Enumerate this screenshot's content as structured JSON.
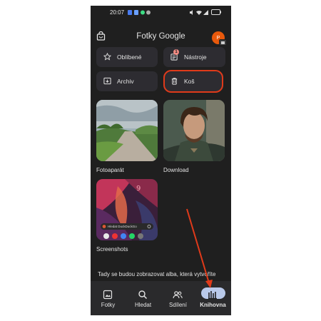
{
  "status_bar": {
    "time": "20:07",
    "battery": "87"
  },
  "app": {
    "title": "Fotky Google",
    "avatar_letter": "P"
  },
  "tiles": [
    {
      "label": "Oblíbené",
      "icon": "star-icon"
    },
    {
      "label": "Nástroje",
      "icon": "tools-icon",
      "badge": "1"
    },
    {
      "label": "Archiv",
      "icon": "archive-icon"
    },
    {
      "label": "Koš",
      "icon": "trash-icon"
    }
  ],
  "albums": [
    {
      "label": "Fotoaparát"
    },
    {
      "label": "Download"
    },
    {
      "label": "Screenshots",
      "search_hint": "Hledat DuckDuckGo"
    }
  ],
  "info_text": "Tady se budou zobrazovat alba, která vytvoříte",
  "nav": [
    {
      "label": "Fotky",
      "icon": "photo-icon"
    },
    {
      "label": "Hledat",
      "icon": "search-icon"
    },
    {
      "label": "Sdílení",
      "icon": "people-icon"
    },
    {
      "label": "Knihovna",
      "icon": "library-icon",
      "active": true
    }
  ],
  "colors": {
    "background": "#1f1f1f",
    "tile": "#2d2c31",
    "highlight": "#e03a1a",
    "active_pill": "#b9c9ea"
  }
}
